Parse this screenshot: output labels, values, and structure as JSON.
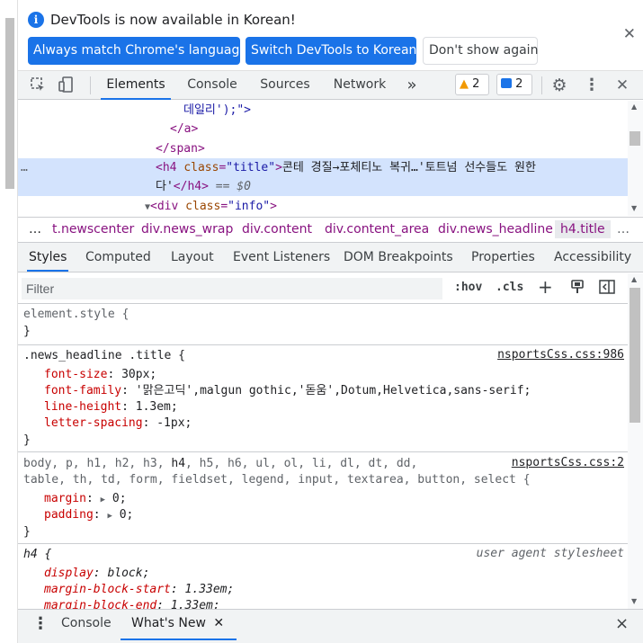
{
  "infobar": {
    "message": "DevTools is now available in Korean!",
    "btn_match": "Always match Chrome's language",
    "btn_switch": "Switch DevTools to Korean",
    "btn_dismiss": "Don't show again"
  },
  "toolbar": {
    "tabs": [
      "Elements",
      "Console",
      "Sources",
      "Network"
    ],
    "more": "»",
    "warnings": "2",
    "messages": "2"
  },
  "dom": {
    "line1": "데일리');\">",
    "line2": "</a>",
    "line3": "</span>",
    "h4_open": "<h4",
    "h4_attr": "class",
    "h4_val": "\"title\"",
    "h4_gt": ">",
    "h4_text1": "콘테 경질→포체티노 복귀…'토트넘 선수들도 원한",
    "h4_text2": "다'",
    "h4_close": "</h4>",
    "h4_eq": "== $0",
    "div_open": "<div",
    "div_attr": "class",
    "div_val": "\"info\"",
    "div_gt": ">",
    "ellipsis": "…"
  },
  "breadcrumb": {
    "items": [
      "…",
      "t.newscenter",
      "div.news_wrap",
      "div.content",
      "div.content_area",
      "div.news_headline",
      "h4.title",
      "…"
    ]
  },
  "panel_tabs": [
    "Styles",
    "Computed",
    "Layout",
    "Event Listeners",
    "DOM Breakpoints",
    "Properties",
    "Accessibility"
  ],
  "filter": {
    "placeholder": "Filter",
    "hov": ":hov",
    "cls": ".cls",
    "plus": "+"
  },
  "styles": {
    "r1": {
      "selector": "element.style {",
      "close": "}"
    },
    "r2": {
      "selector": ".news_headline .title {",
      "source": "nsportsCss.css:986",
      "p1n": "font-size",
      "p1v": "30px;",
      "p2n": "font-family",
      "p2v": "'맑은고딕',malgun gothic,'돋움',Dotum,Helvetica,sans-serif;",
      "p3n": "line-height",
      "p3v": "1.3em;",
      "p4n": "letter-spacing",
      "p4v": "-1px;",
      "close": "}"
    },
    "r3": {
      "sel_a": "body, p, h1, h2, h3, ",
      "sel_b": "h4",
      "sel_c": ", h5, h6, ul, ol, li, dl, dt, dd,",
      "sel_d": "table, th, td, form, fieldset, legend, input, textarea, button, select {",
      "source": "nsportsCss.css:2",
      "p1n": "margin",
      "p1v": "0;",
      "p2n": "padding",
      "p2v": "0;",
      "close": "}"
    },
    "r4": {
      "selector": "h4 {",
      "source": "user agent stylesheet",
      "p1n": "display",
      "p1v": "block;",
      "p2n": "margin-block-start",
      "p2v": "1.33em;",
      "p3n": "margin-block-end",
      "p3v": "1.33em;"
    }
  },
  "drawer": {
    "console": "Console",
    "whats_new": "What's New",
    "close": "×"
  }
}
